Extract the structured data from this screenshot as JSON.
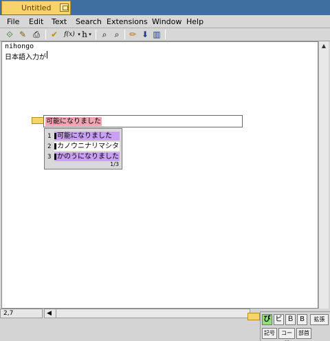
{
  "window": {
    "title": "Untitled"
  },
  "menubar": {
    "items": [
      "File",
      "Edit",
      "Text",
      "Search",
      "Extensions",
      "Window",
      "Help"
    ]
  },
  "toolbar": {
    "buttons": [
      {
        "icon": "open-icon",
        "glyph": "⟐"
      },
      {
        "icon": "save-icon",
        "glyph": "✎"
      },
      {
        "icon": "print-icon",
        "glyph": "⎙"
      },
      {
        "icon": "spellcheck-icon",
        "glyph": "✔"
      },
      {
        "icon": "function-icon",
        "label": "f(x)"
      },
      {
        "icon": "heading-icon",
        "label": "h"
      },
      {
        "icon": "find-icon",
        "glyph": "⌕"
      },
      {
        "icon": "find-next-icon",
        "glyph": "⌕"
      },
      {
        "icon": "pencil-icon",
        "glyph": "✏"
      },
      {
        "icon": "insert-icon",
        "glyph": "⬇"
      },
      {
        "icon": "columns-icon",
        "glyph": "▥"
      }
    ]
  },
  "editor": {
    "lines": [
      "nihongo",
      "日本語入力が"
    ]
  },
  "ime": {
    "preedit": "可能になりました",
    "candidates": [
      {
        "num": "1",
        "text": "可能になりました",
        "selected": true
      },
      {
        "num": "2",
        "text": "カノウニナリマシタ",
        "selected": false
      },
      {
        "num": "3",
        "text": "かのうになりました",
        "selected": true
      }
    ],
    "page": "1/3",
    "palette": {
      "row1": [
        "び",
        "ビ",
        "Ｂ",
        "B",
        "拡張"
      ],
      "row2": [
        "記号",
        "コード",
        "部首"
      ]
    }
  },
  "status": {
    "position": "2,7",
    "scroll_left": "◀"
  },
  "colors": {
    "titlebar": "#3f6ea1",
    "tab": "#f7d46a",
    "preedit_highlight": "#f4a3b2",
    "candidate_highlight": "#c9a0f4",
    "ime_active": "#8fe07a"
  }
}
